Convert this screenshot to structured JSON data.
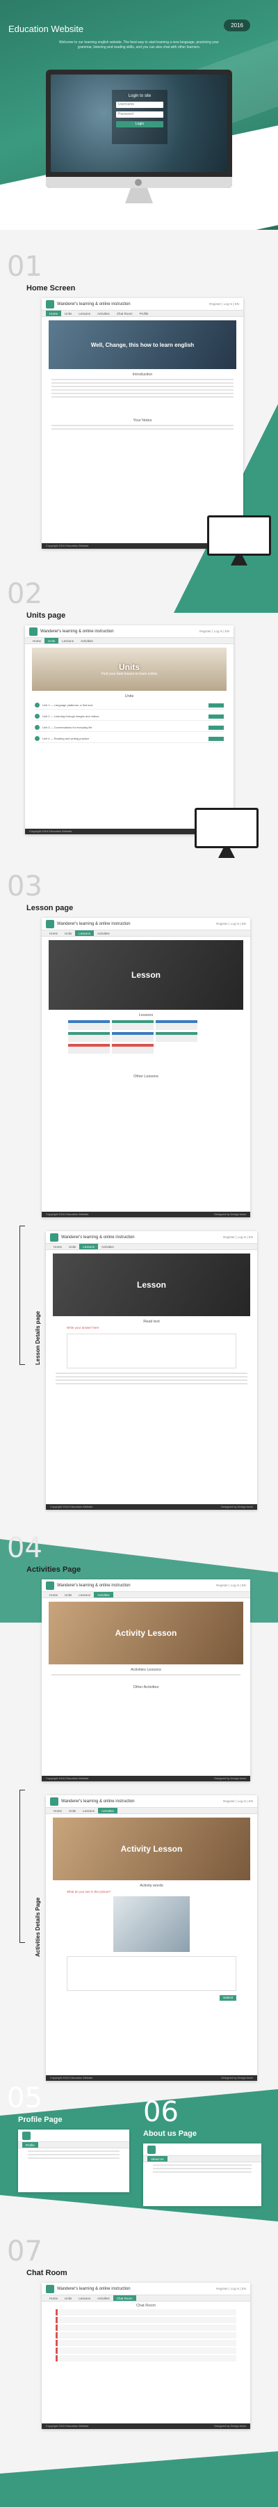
{
  "hero": {
    "title": "Education Website",
    "year": "2016",
    "description": "Welcome to our learning english website. The best way to start learning a new language, practicing your grammar, listening and reading skills, and you can also chat with other learners.",
    "login": {
      "title": "Login to site",
      "user_placeholder": "Username",
      "pass_placeholder": "Password",
      "button": "Login"
    }
  },
  "sections": [
    {
      "num": "01",
      "title": "Home Screen"
    },
    {
      "num": "02",
      "title": "Units page"
    },
    {
      "num": "03",
      "title": "Lesson page"
    },
    {
      "num": "04",
      "title": "Activities Page"
    },
    {
      "num": "05",
      "title": "Profile Page"
    },
    {
      "num": "06",
      "title": "About us Page"
    },
    {
      "num": "07",
      "title": "Chat Room"
    }
  ],
  "side_labels": {
    "lesson_details": "Lesson Details page",
    "activities_details": "Activities Details Page"
  },
  "site": {
    "name": "Wanderer's learning & online instruction",
    "util": "Register | Log In | EN",
    "nav": [
      "Home",
      "Units",
      "Lessons",
      "Activities",
      "Chat Room",
      "Profile",
      "About Us"
    ],
    "footer_left": "Copyright 2016 Education Website",
    "footer_right": "Designed by Design team"
  },
  "home": {
    "banner": "Well, Change, this how to learn english",
    "intro": "Introduction",
    "more": "Your Notes"
  },
  "units": {
    "banner": "Units",
    "banner_sub": "Find your best lesson to learn online",
    "heading": "Units",
    "rows": [
      "Unit 1 — Language platforms: a first look",
      "Unit 2 — Learning through images and videos",
      "Unit 3 — Conversations for everyday life",
      "Unit 4 — Reading and writing practice"
    ]
  },
  "lesson": {
    "banner": "Lesson",
    "heading": "Lessons",
    "more": "Other Lessons"
  },
  "lesson_details": {
    "banner": "Lesson",
    "heading": "Read text",
    "question": "Write your answer here"
  },
  "activities": {
    "banner": "Activity Lesson",
    "heading": "Activities Lessons",
    "more": "Other Activities"
  },
  "activities_details": {
    "banner": "Activity Lesson",
    "heading": "Activity words",
    "question": "What do you see in the picture?",
    "submit": "Submit"
  },
  "chat": {
    "heading": "Chat Room"
  }
}
